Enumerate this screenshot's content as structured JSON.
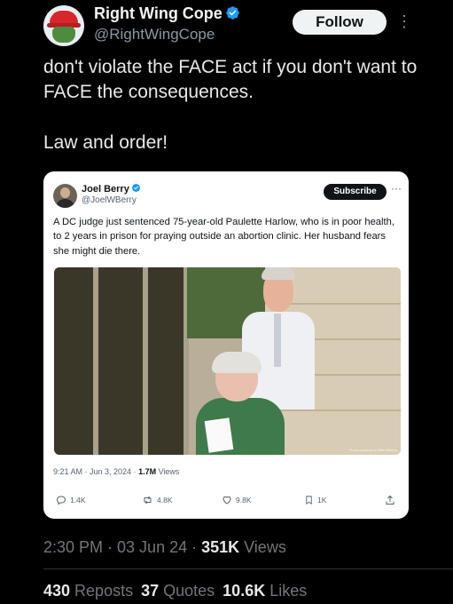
{
  "author": {
    "name": "Right Wing Cope",
    "handle": "@RightWingCope",
    "verified_color": "#1d9bf0"
  },
  "follow_label": "Follow",
  "tweet": {
    "text_1": "don't violate the FACE act if you don't want to FACE the consequences.",
    "text_2": "Law and order!"
  },
  "quote": {
    "name": "Joel Berry",
    "handle": "@JoelWBerry",
    "subscribe_label": "Subscribe",
    "text": "A DC judge just sentenced 75-year-old Paulette Harlow, who is in poor health, to 2 years in prison for praying outside an abortion clinic. Her husband fears she might die there.",
    "photo_credit": "Photo courtesy of John Harlow",
    "time": "9:21 AM · Jun 3, 2024 · ",
    "views_count": "1.7M",
    "views_label": " Views",
    "actions": {
      "replies": "1.4K",
      "reposts": "4.8K",
      "likes": "9.8K",
      "bookmarks": "1K"
    }
  },
  "timestamp": {
    "time": "2:30 PM · 03 Jun 24 · ",
    "views_count": "351K",
    "views_label": " Views"
  },
  "stats": {
    "reposts_count": "430",
    "reposts_label": " Reposts",
    "quotes_count": "37",
    "quotes_label": " Quotes",
    "likes_count": "10.6K",
    "likes_label": " Likes"
  },
  "icons": [
    "verified-badge-icon",
    "more-icon",
    "reply-icon",
    "repost-icon",
    "like-icon",
    "bookmark-icon",
    "share-icon"
  ]
}
